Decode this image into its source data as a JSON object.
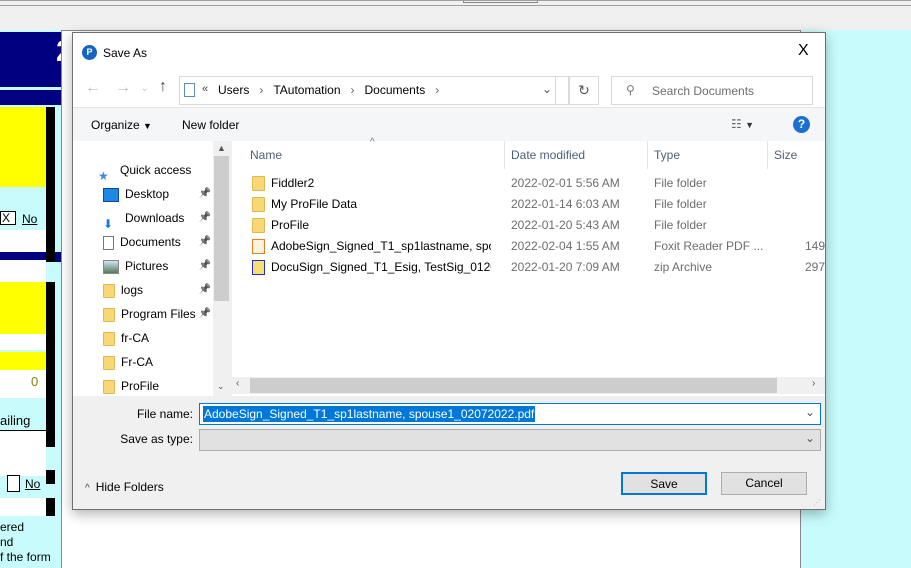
{
  "background_app": {
    "left_texts": [
      "X",
      "No",
      "0",
      "ailing",
      "No",
      "ered",
      "nd",
      "f the form"
    ],
    "big_char": "2"
  },
  "dialog": {
    "title": "Save As",
    "close": "X",
    "breadcrumb": {
      "prefix": "«",
      "items": [
        "Users",
        "TAutomation",
        "Documents"
      ]
    },
    "search_placeholder": "Search Documents",
    "toolbar": {
      "organize": "Organize",
      "new_folder": "New folder",
      "help": "?"
    },
    "nav_items": [
      {
        "label": "Quick access",
        "icon": "star-icon",
        "pinned": false
      },
      {
        "label": "Desktop",
        "icon": "desktop-icon",
        "pinned": true
      },
      {
        "label": "Downloads",
        "icon": "download-icon",
        "pinned": true
      },
      {
        "label": "Documents",
        "icon": "document-icon",
        "pinned": true
      },
      {
        "label": "Pictures",
        "icon": "pictures-icon",
        "pinned": true
      },
      {
        "label": "logs",
        "icon": "folder-icon",
        "pinned": true
      },
      {
        "label": "Program Files",
        "icon": "folder-icon",
        "pinned": true
      },
      {
        "label": "fr-CA",
        "icon": "folder-icon",
        "pinned": false
      },
      {
        "label": "Fr-CA",
        "icon": "folder-icon",
        "pinned": false
      },
      {
        "label": "ProFile",
        "icon": "folder-icon",
        "pinned": false
      }
    ],
    "columns": [
      "Name",
      "Date modified",
      "Type",
      "Size"
    ],
    "files": [
      {
        "name": "Fiddler2",
        "date": "2022-02-01 5:56 AM",
        "type": "File folder",
        "size": "",
        "icon": "folder-icon"
      },
      {
        "name": "My ProFile Data",
        "date": "2022-01-14 6:03 AM",
        "type": "File folder",
        "size": "",
        "icon": "folder-icon"
      },
      {
        "name": "ProFile",
        "date": "2022-01-20 5:43 AM",
        "type": "File folder",
        "size": "",
        "icon": "folder-icon"
      },
      {
        "name": "AdobeSign_Signed_T1_sp1lastname, spo...",
        "date": "2022-02-04 1:55 AM",
        "type": "Foxit Reader PDF ...",
        "size": "149",
        "icon": "pdf-icon"
      },
      {
        "name": "DocuSign_Signed_T1_Esig, TestSig_01202...",
        "date": "2022-01-20 7:09 AM",
        "type": "zip Archive",
        "size": "297",
        "icon": "zip-icon"
      }
    ],
    "file_name_label": "File name:",
    "file_name_value": "AdobeSign_Signed_T1_sp1lastname, spouse1_02072022.pdf",
    "save_as_type_label": "Save as type:",
    "save_as_type_value": "",
    "hide_folders": "Hide Folders",
    "save": "Save",
    "cancel": "Cancel",
    "accent": "#0078d7"
  }
}
